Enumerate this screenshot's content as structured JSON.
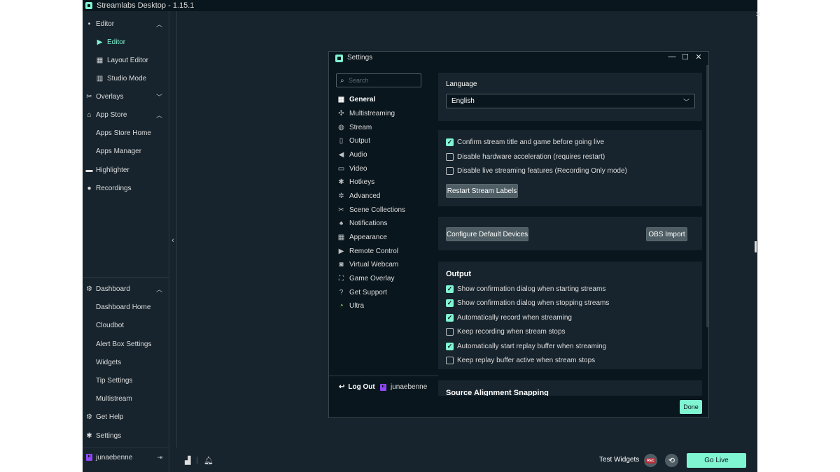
{
  "app": {
    "title": "Streamlabs Desktop - 1.15.1",
    "accent_color": "#80f5d2",
    "background_color": "#17242d"
  },
  "sidebar": {
    "editor": {
      "label": "Editor",
      "icon": "editor-icon"
    },
    "editor_sub": {
      "label": "Editor",
      "icon": "camera-icon"
    },
    "layout_editor": {
      "label": "Layout Editor",
      "icon": "grid-icon"
    },
    "studio_mode": {
      "label": "Studio Mode",
      "icon": "columns-icon"
    },
    "overlays": {
      "label": "Overlays",
      "icon": "overlays-icon"
    },
    "app_store": {
      "label": "App Store",
      "icon": "store-icon"
    },
    "apps_store_home": {
      "label": "Apps Store Home"
    },
    "apps_manager": {
      "label": "Apps Manager"
    },
    "highlighter": {
      "label": "Highlighter",
      "icon": "highlighter-icon"
    },
    "recordings": {
      "label": "Recordings",
      "icon": "play-icon"
    },
    "dashboard": {
      "label": "Dashboard",
      "icon": "dashboard-icon"
    },
    "dashboard_home": {
      "label": "Dashboard Home"
    },
    "cloudbot": {
      "label": "Cloudbot"
    },
    "alert_box_settings": {
      "label": "Alert Box Settings"
    },
    "widgets": {
      "label": "Widgets"
    },
    "tip_settings": {
      "label": "Tip Settings"
    },
    "multistream": {
      "label": "Multistream"
    },
    "get_help": {
      "label": "Get Help",
      "icon": "help-icon"
    },
    "settings": {
      "label": "Settings",
      "icon": "gear-icon"
    },
    "username": "junaebenne"
  },
  "footer": {
    "test_widgets": "Test Widgets",
    "rec_badge": "REC",
    "go_live": "Go Live"
  },
  "settings_dialog": {
    "title": "Settings",
    "search_placeholder": "Search",
    "nav": [
      {
        "label": "General",
        "icon": "grid-icon"
      },
      {
        "label": "Multistreaming",
        "icon": "multistream-icon"
      },
      {
        "label": "Stream",
        "icon": "globe-icon"
      },
      {
        "label": "Output",
        "icon": "output-icon"
      },
      {
        "label": "Audio",
        "icon": "speaker-icon"
      },
      {
        "label": "Video",
        "icon": "video-icon"
      },
      {
        "label": "Hotkeys",
        "icon": "gear-icon"
      },
      {
        "label": "Advanced",
        "icon": "wrench-icon"
      },
      {
        "label": "Scene Collections",
        "icon": "collections-icon"
      },
      {
        "label": "Notifications",
        "icon": "bell-icon"
      },
      {
        "label": "Appearance",
        "icon": "appearance-icon"
      },
      {
        "label": "Remote Control",
        "icon": "remote-icon"
      },
      {
        "label": "Virtual Webcam",
        "icon": "camera-icon"
      },
      {
        "label": "Game Overlay",
        "icon": "overlay-icon"
      },
      {
        "label": "Get Support",
        "icon": "help-icon"
      },
      {
        "label": "Ultra",
        "icon": "ultra-icon"
      }
    ],
    "logout": "Log Out",
    "username": "junaebenne",
    "language": {
      "label": "Language",
      "value": "English"
    },
    "general_checkboxes": [
      {
        "label": "Confirm stream title and game before going live",
        "checked": true
      },
      {
        "label": "Disable hardware acceleration (requires restart)",
        "checked": false
      },
      {
        "label": "Disable live streaming features (Recording Only mode)",
        "checked": false
      }
    ],
    "restart_stream_labels": "Restart Stream Labels",
    "configure_default_devices": "Configure Default Devices",
    "obs_import": "OBS Import",
    "output": {
      "title": "Output",
      "checkboxes": [
        {
          "label": "Show confirmation dialog when starting streams",
          "checked": true
        },
        {
          "label": "Show confirmation dialog when stopping streams",
          "checked": true
        },
        {
          "label": "Automatically record when streaming",
          "checked": true
        },
        {
          "label": "Keep recording when stream stops",
          "checked": false
        },
        {
          "label": "Automatically start replay buffer when streaming",
          "checked": true
        },
        {
          "label": "Keep replay buffer active when stream stops",
          "checked": false
        }
      ]
    },
    "source_alignment_title": "Source Alignment Snapping",
    "done": "Done"
  }
}
